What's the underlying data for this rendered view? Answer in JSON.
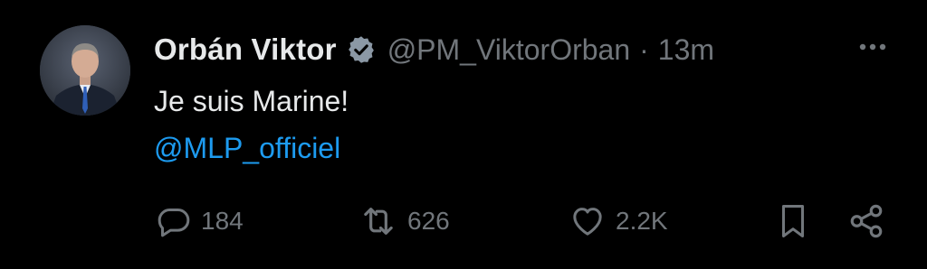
{
  "tweet": {
    "display_name": "Orbán Viktor",
    "handle": "@PM_ViktorOrban",
    "separator": "·",
    "time": "13m",
    "text": "Je suis Marine!",
    "mention": "@MLP_officiel"
  },
  "actions": {
    "replies": "184",
    "reposts": "626",
    "likes": "2.2K"
  },
  "icons": {
    "verified": "verified-badge-icon",
    "more": "more-horizontal-icon",
    "reply": "reply-icon",
    "repost": "repost-icon",
    "like": "heart-icon",
    "bookmark": "bookmark-icon",
    "share": "share-icon"
  },
  "colors": {
    "background": "#000000",
    "text_primary": "#e7e9ea",
    "text_secondary": "#71767b",
    "link": "#1d9bf0"
  }
}
